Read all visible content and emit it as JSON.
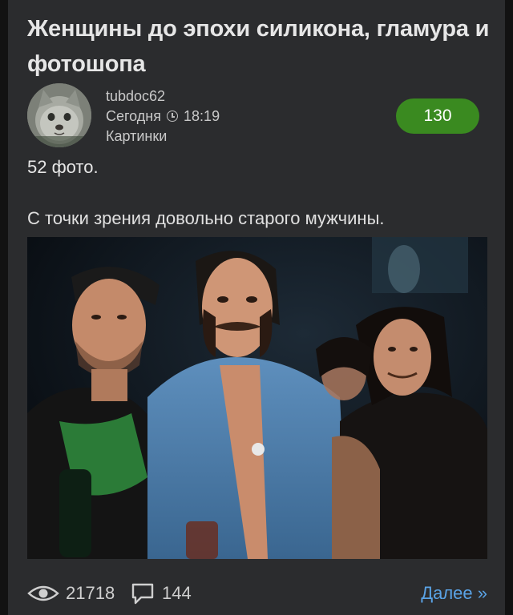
{
  "post": {
    "title": "Женщины до эпохи силикона, гламура и фотошопа",
    "author": "tubdoc62",
    "date": "Сегодня",
    "time": "18:19",
    "category": "Картинки",
    "rating": "130",
    "photo_count": "52 фото.",
    "caption": "С точки зрения довольно старого мужчины."
  },
  "footer": {
    "views": "21718",
    "comments": "144",
    "more_label": "Далее »"
  },
  "colors": {
    "card_bg": "#2b2c2e",
    "rating_bg": "#3a8a20",
    "link": "#5aa3e6"
  },
  "icons": [
    "eye-icon",
    "comment-icon",
    "clock-icon"
  ]
}
